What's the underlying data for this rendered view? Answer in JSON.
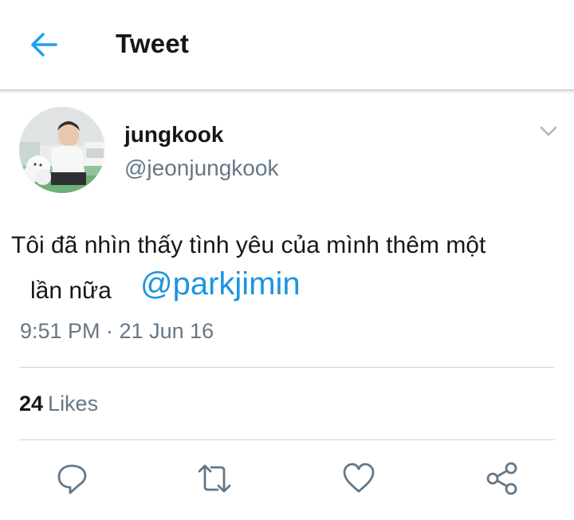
{
  "header": {
    "title": "Tweet",
    "back_icon": "arrow-left-icon",
    "accent_color": "#1da1f2"
  },
  "tweet": {
    "author": {
      "display_name": "jungkook",
      "handle": "@jeonjungkook",
      "avatar_icon": "profile-photo"
    },
    "menu_icon": "chevron-down-icon",
    "text_line1": "Tôi đã nhìn thấy tình yêu của mình thêm một",
    "text_line2": "lần nữa",
    "mention": "@parkjimin",
    "mention_color": "#1b95e0",
    "timestamp": "9:51 PM · 21 Jun 16"
  },
  "stats": {
    "likes_count": "24",
    "likes_label": "Likes"
  },
  "actions": [
    {
      "name": "reply",
      "icon": "reply-icon"
    },
    {
      "name": "retweet",
      "icon": "retweet-icon"
    },
    {
      "name": "like",
      "icon": "heart-icon"
    },
    {
      "name": "share",
      "icon": "share-icon"
    }
  ]
}
